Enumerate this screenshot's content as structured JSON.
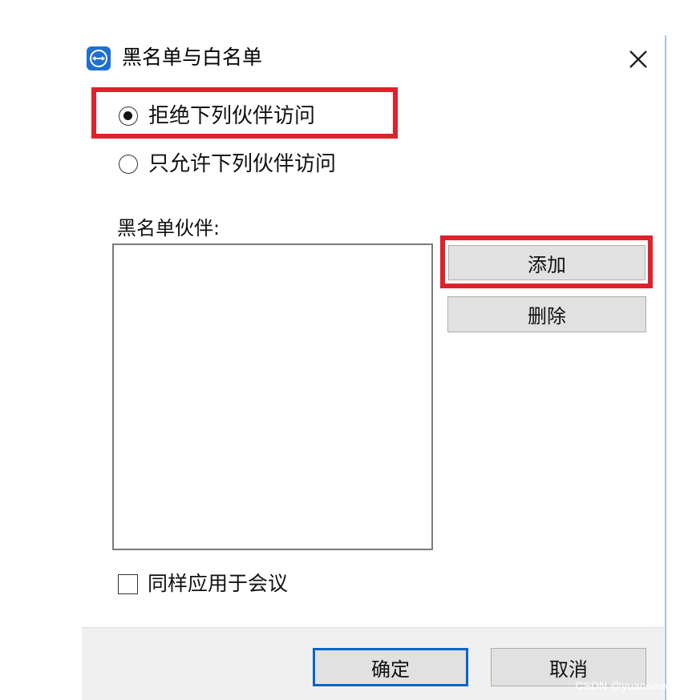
{
  "window": {
    "title": "黑名单与白名单",
    "app_icon": "teamviewer-icon",
    "close_icon": "close-icon"
  },
  "options": {
    "deny": {
      "label": "拒绝下列伙伴访问",
      "checked": true
    },
    "allow": {
      "label": "只允许下列伙伴访问",
      "checked": false
    }
  },
  "partners": {
    "label": "黑名单伙伴:",
    "items": []
  },
  "actions": {
    "add_label": "添加",
    "delete_label": "删除"
  },
  "meeting_option": {
    "label": "同样应用于会议",
    "checked": false
  },
  "footer": {
    "ok_label": "确定",
    "cancel_label": "取消"
  },
  "watermark": "CSDN @yuanseovip",
  "colors": {
    "highlight": "#e0202b",
    "primary_border": "#0a63c9",
    "app_icon": "#1e6fce"
  }
}
